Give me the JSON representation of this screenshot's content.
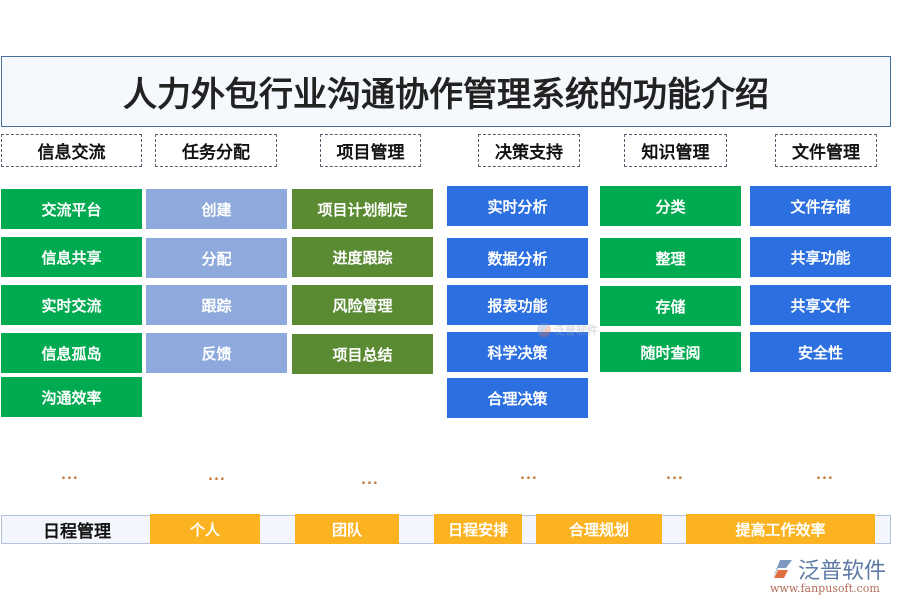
{
  "title": "人力外包行业沟通协作管理系统的功能介绍",
  "categories": [
    {
      "label": "信息交流",
      "color": "#00aa50",
      "items": [
        "交流平台",
        "信息共享",
        "实时交流",
        "信息孤岛",
        "沟通效率"
      ],
      "more": "..."
    },
    {
      "label": "任务分配",
      "color": "#8eaadc",
      "items": [
        "创建",
        "分配",
        "跟踪",
        "反馈"
      ],
      "more": "..."
    },
    {
      "label": "项目管理",
      "color": "#5a8a32",
      "items": [
        "项目计划制定",
        "进度跟踪",
        "风险管理",
        "项目总结"
      ],
      "more": "..."
    },
    {
      "label": "决策支持",
      "color": "#2c6fe0",
      "items": [
        "实时分析",
        "数据分析",
        "报表功能",
        "科学决策",
        "合理决策"
      ],
      "more": "..."
    },
    {
      "label": "知识管理",
      "color": "#00aa50",
      "items": [
        "分类",
        "整理",
        "存储",
        "随时查阅"
      ],
      "more": "..."
    },
    {
      "label": "文件管理",
      "color": "#2c6fe0",
      "items": [
        "文件存储",
        "共享功能",
        "共享文件",
        "安全性"
      ],
      "more": "..."
    }
  ],
  "schedule": {
    "label": "日程管理",
    "color": "#fbb321",
    "items": [
      "个人",
      "团队",
      "日程安排",
      "合理规划",
      "提高工作效率"
    ]
  },
  "watermark": {
    "center_text": "泛普软件",
    "brand_name": "泛普软件",
    "brand_url": "www.fanpusoft.com"
  }
}
